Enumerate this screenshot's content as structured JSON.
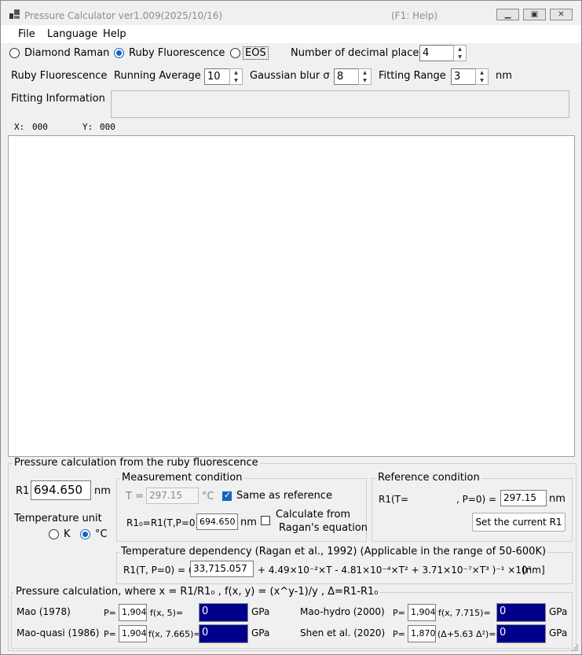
{
  "window": {
    "title": "Pressure Calculator  ver1.009(2025/10/16)",
    "help_hint": "(F1: Help)"
  },
  "menu": [
    "File",
    "Language",
    "Help"
  ],
  "modes": {
    "diamond": "Diamond Raman",
    "ruby": "Ruby Fluorescence",
    "eos": "EOS",
    "selected": "ruby"
  },
  "decimal": {
    "label": "Number of decimal places",
    "value": "4"
  },
  "ruby_row": {
    "title": "Ruby Fluorescence",
    "running_avg_label": "Running Average",
    "running_avg_value": "10",
    "gauss_label": "Gaussian blur σ",
    "gauss_value": "8",
    "fitting_label": "Fitting Range",
    "fitting_value": "3",
    "fitting_unit": "nm"
  },
  "fitting_info": {
    "label": "Fitting Information",
    "value": ""
  },
  "coords": {
    "x_label": "X:",
    "x_value": "000",
    "y_label": "Y:",
    "y_value": "000"
  },
  "pressure": {
    "title": "Pressure calculation from the ruby fluorescence",
    "r1_label": "R1",
    "r1_value": "694.650",
    "r1_unit": "nm",
    "temp_unit_label": "Temperature unit",
    "temp_k": "K",
    "temp_c": "°C",
    "temp_selected": "C"
  },
  "measurement": {
    "title": "Measurement condition",
    "t_label": "T =",
    "t_value": "297.15",
    "t_unit": "°C",
    "same_ref": "Same as reference",
    "same_ref_checked": true,
    "r10_label": "R1₀=R1(T,P=0)",
    "r10_value": "694.650",
    "r10_unit": "nm",
    "calc_from_1": "Calculate from",
    "calc_from_2": "Ragan's equation",
    "calc_checked": false
  },
  "reference": {
    "title": "Reference condition",
    "r1t_label": "R1(T=",
    "p0_label": ", P=0) =",
    "r1t_value": "297.15",
    "unit": "nm",
    "set_button": "Set the current R1"
  },
  "temp_dep": {
    "title": "Temperature dependency (Ragan et al., 1992) (Applicable in the range of 50-600K)",
    "prefix": "R1(T, P=0) = (",
    "value": "33,715.057",
    "suffix": "+ 4.49×10⁻²×T - 4.81×10⁻⁴×T² + 3.71×10⁻⁷×T³ )⁻¹ ×10⁷",
    "unit": "[nm]"
  },
  "calc": {
    "title": "Pressure calculation, where x = R1/R1₀ ,  f(x, y) = (x^y-1)/y ,  Δ=R1-R1₀",
    "rows": [
      {
        "name": "Mao (1978)",
        "p_label": "P=",
        "p_value": "1,904",
        "f_label": "f(x, 5)=",
        "result": "0",
        "unit": "GPa"
      },
      {
        "name": "Mao-hydro (2000)",
        "p_label": "P=",
        "p_value": "1,904",
        "f_label": "f(x, 7.715)=",
        "result": "0",
        "unit": "GPa"
      },
      {
        "name": "Mao-quasi (1986)",
        "p_label": "P=",
        "p_value": "1,904",
        "f_label": "f(x, 7.665)=",
        "result": "0",
        "unit": "GPa"
      },
      {
        "name": "Shen et al. (2020)",
        "p_label": "P=",
        "p_value": "1,870",
        "f_label": "(Δ+5.63 Δ²)=",
        "result": "0",
        "unit": "GPa"
      }
    ]
  }
}
